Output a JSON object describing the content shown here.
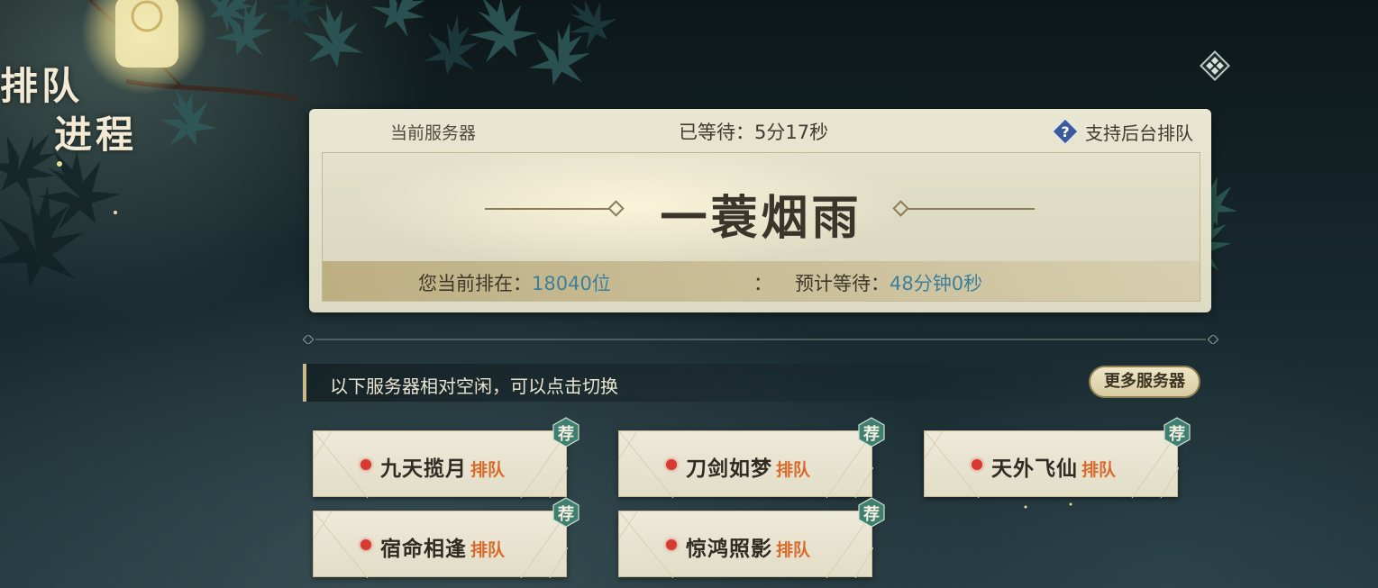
{
  "page": {
    "title_line1": "排队",
    "title_line2": "进程"
  },
  "queue_card": {
    "current_server_label": "当前服务器",
    "waited_label": "已等待：",
    "waited_value": "5分17秒",
    "background_queue_label": "支持后台排队",
    "server_name": "一蓑烟雨",
    "rank_label": "您当前排在：",
    "rank_value": "18040位",
    "separator": "：",
    "estimate_label": "预计等待：",
    "estimate_value": "48分钟0秒"
  },
  "alternatives": {
    "hint": "以下服务器相对空闲，可以点击切换",
    "more_button": "更多服务器",
    "servers": [
      {
        "name": "九天揽月",
        "status": "排队",
        "badge": "荐"
      },
      {
        "name": "刀剑如梦",
        "status": "排队",
        "badge": "荐"
      },
      {
        "name": "天外飞仙",
        "status": "排队",
        "badge": "荐"
      },
      {
        "name": "宿命相逢",
        "status": "排队",
        "badge": "荐"
      },
      {
        "name": "惊鸿照影",
        "status": "排队",
        "badge": "荐"
      }
    ]
  },
  "colors": {
    "accent_blue": "#3e7f9a",
    "status_orange": "#d96a2a",
    "status_dot_red": "#d73a32",
    "badge_green": "#3f7f70"
  }
}
